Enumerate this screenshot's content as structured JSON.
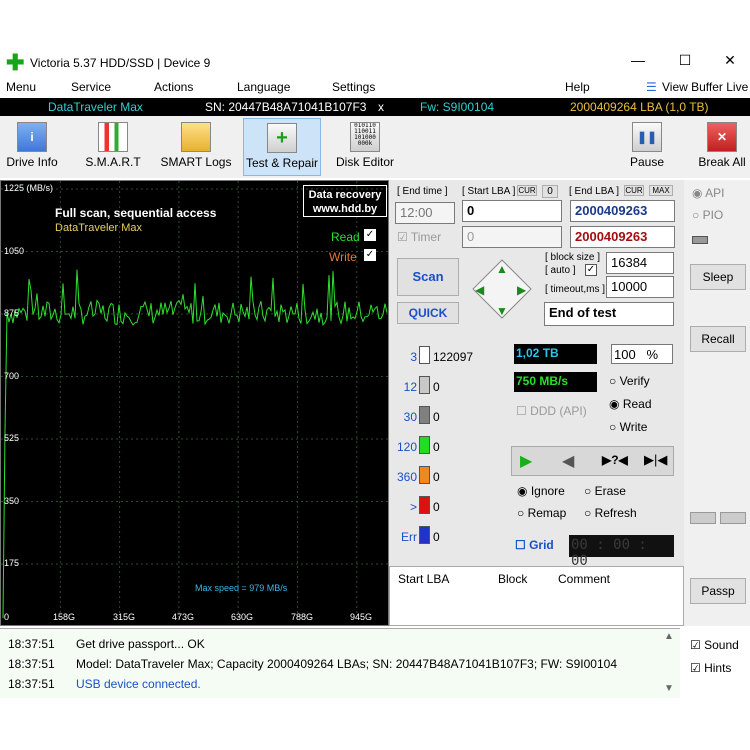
{
  "window": {
    "title": "Victoria 5.37 HDD/SSD | Device 9",
    "minimize": "—",
    "maximize": "☐",
    "close": "✕"
  },
  "menu": {
    "items": [
      "Menu",
      "Service",
      "Actions",
      "Language",
      "Settings",
      "Help"
    ],
    "buffer": "View Buffer Live"
  },
  "drive": {
    "model": "DataTraveler Max",
    "sn": "SN: 20447B48A71041B107F3",
    "x": "x",
    "fw": "Fw: S9I00104",
    "lba": "2000409264 LBA (1,0 TB)"
  },
  "toolbar": {
    "drive_info": "Drive Info",
    "smart": "S.M.A.R.T",
    "smart_logs": "SMART Logs",
    "test_repair": "Test & Repair",
    "disk_editor": "Disk Editor",
    "pause": "Pause",
    "break_all": "Break All"
  },
  "graph": {
    "title": "Full scan, sequential access",
    "subtitle": "DataTraveler Max",
    "unit": "1225 (MB/s)",
    "yticks": [
      "1050",
      "875",
      "700",
      "525",
      "350",
      "175",
      "0"
    ],
    "xticks": [
      "158G",
      "315G",
      "473G",
      "630G",
      "788G",
      "945G"
    ],
    "read": "Read",
    "write": "Write",
    "max_speed": "Max speed = 979 MB/s",
    "logo1": "Data recovery",
    "logo2": "www.hdd.by",
    "read_color": "#2ee02e"
  },
  "controls": {
    "end_time_label": "[ End time ]",
    "end_time": "12:00",
    "start_lba_label": "[ Start LBA ]",
    "cur": "CUR",
    "zero": "0",
    "start_lba": "0",
    "end_lba_label": "[ End LBA ]",
    "max": "MAX",
    "end_lba": "2000409263",
    "end_lba2": "2000409263",
    "timer": "Timer",
    "timer_val": "0",
    "block_size_label": "[ block size ]",
    "auto": "[ auto ]",
    "block_size": "16384",
    "timeout_label": "[ timeout,ms ]",
    "timeout": "10000",
    "scan": "Scan",
    "quick": "QUICK",
    "end_of_test": "End of test"
  },
  "blocks": [
    {
      "label": "3",
      "val": "122097",
      "color": "#ffffff"
    },
    {
      "label": "12",
      "val": "0",
      "color": "#c8c8c8"
    },
    {
      "label": "30",
      "val": "0",
      "color": "#808080"
    },
    {
      "label": "120",
      "val": "0",
      "color": "#22dd22"
    },
    {
      "label": "360",
      "val": "0",
      "color": "#ee8822"
    },
    {
      "label": ">",
      "val": "0",
      "color": "#dd1111"
    },
    {
      "label": "Err",
      "val": "0",
      "color": "#2233cc"
    }
  ],
  "stats": {
    "size": "1,02 TB",
    "percent": "100",
    "pct_sign": "%",
    "speed": "750 MB/s",
    "ddd": "DDD (API)",
    "verify": "Verify",
    "read": "Read",
    "write": "Write",
    "ignore": "Ignore",
    "erase": "Erase",
    "remap": "Remap",
    "refresh": "Refresh",
    "grid": "Grid",
    "timer": "00 : 00 : 00"
  },
  "table": {
    "headers": [
      "Start LBA",
      "Block",
      "Comment"
    ]
  },
  "side": {
    "api": "API",
    "pio": "PIO",
    "sleep": "Sleep",
    "recall": "Recall",
    "passp": "Passp",
    "sound": "Sound",
    "hints": "Hints"
  },
  "log": [
    {
      "time": "18:37:51",
      "msg": "Get drive passport... OK",
      "color": "#000000"
    },
    {
      "time": "18:37:51",
      "msg": "Model: DataTraveler Max; Capacity 2000409264 LBAs; SN: 20447B48A71041B107F3; FW: S9I00104",
      "color": "#000000"
    },
    {
      "time": "18:37:51",
      "msg": "USB device connected.",
      "color": "#1a4fc8"
    }
  ]
}
